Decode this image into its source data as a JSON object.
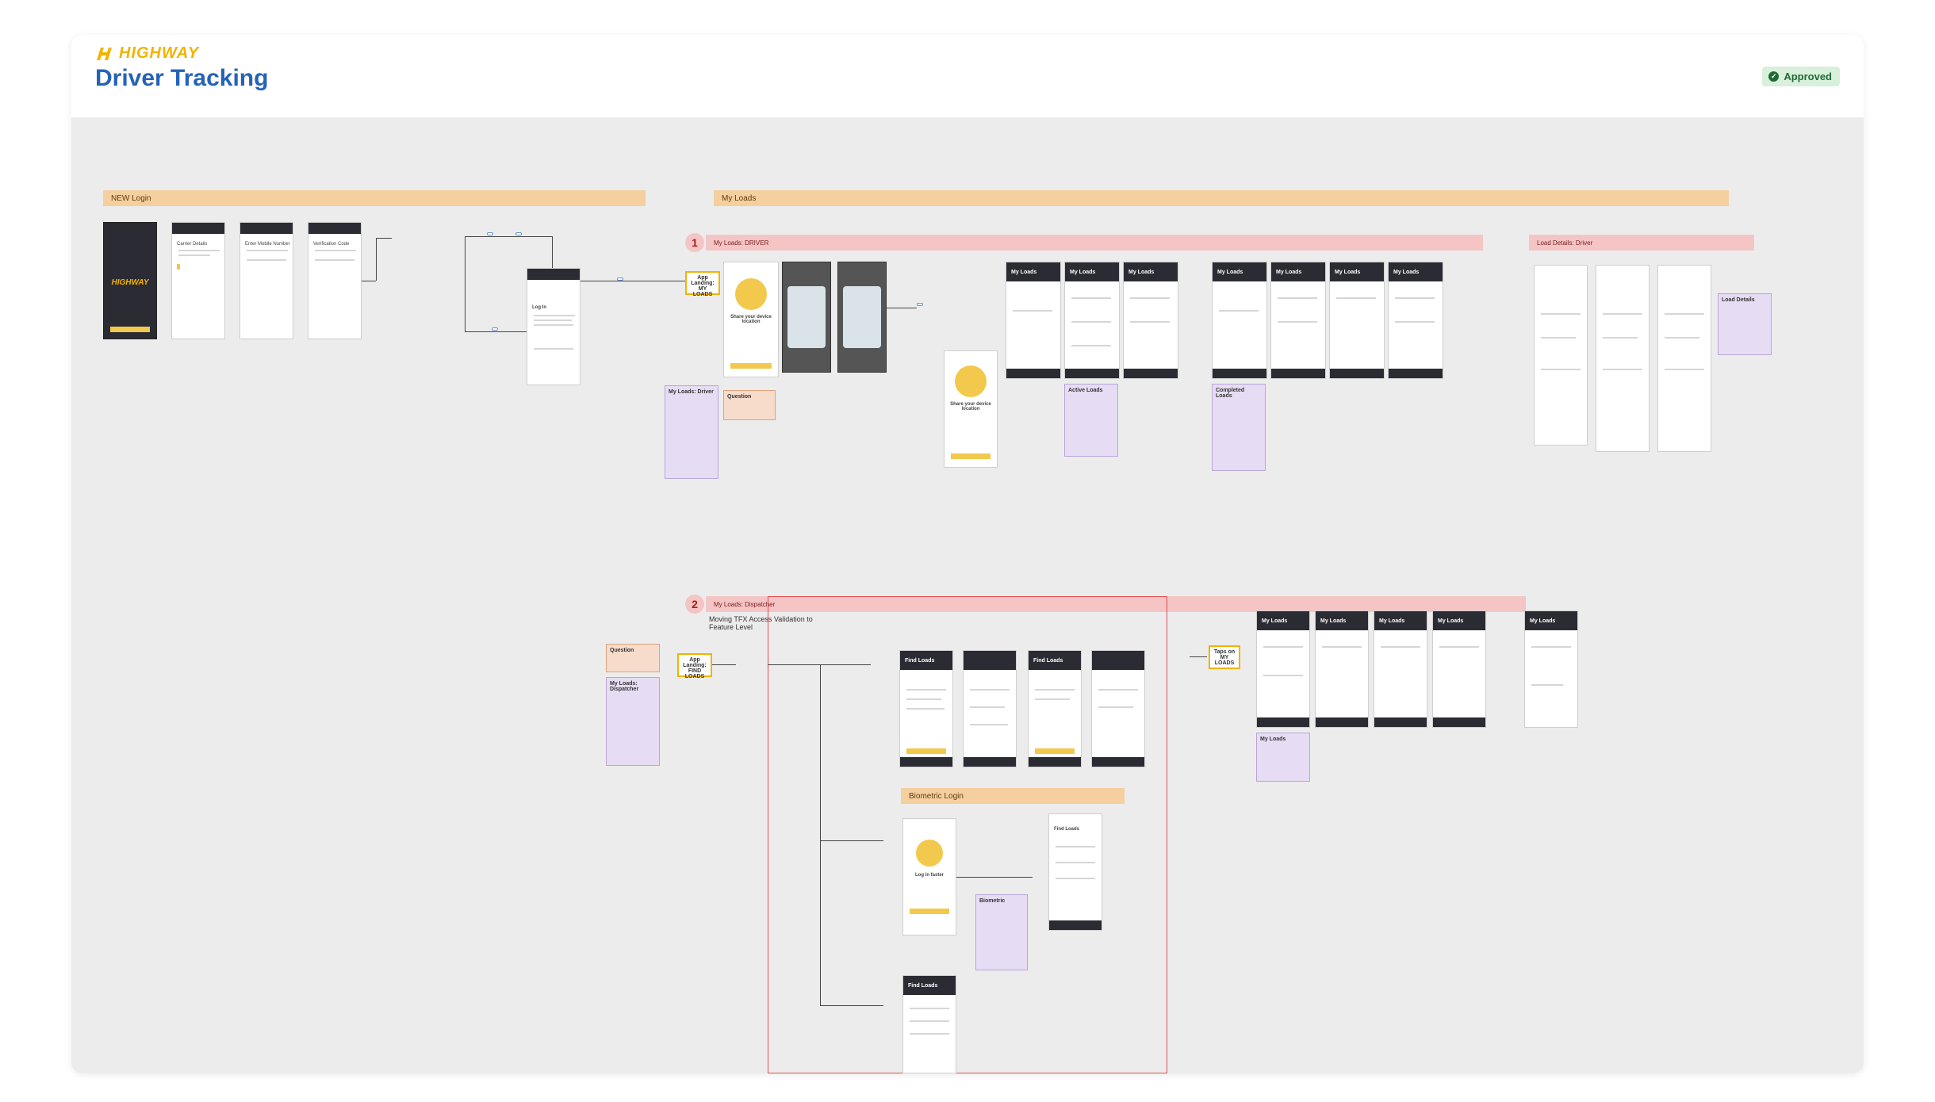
{
  "header": {
    "logo_text": "HIGHWAY",
    "title": "Driver Tracking",
    "status_badge": "Approved"
  },
  "sections": {
    "new_login": "NEW Login",
    "my_loads": "My Loads",
    "driver_band": "My Loads: DRIVER",
    "dispatcher_band": "My Loads: Dispatcher",
    "load_details_band": "Load Details: Driver",
    "biometric_band": "Biometric Login",
    "number_1": "1",
    "number_2": "2"
  },
  "flow": {
    "app_landing_my_loads": "App Landing: MY LOADS",
    "app_landing_find_loads": "App Landing: FIND LOADS",
    "moving_tfx": "Moving TFX Access Validation to Feature Level",
    "taps_on_my_loads": "Taps on MY LOADS"
  },
  "screens": {
    "brand": "HIGHWAY",
    "carrier_details": "Carrier Details",
    "enter_mobile": "Enter Mobile Number",
    "verification_code": "Verification Code",
    "log_in": "Log In",
    "share_location": "Share your device location",
    "my_loads": "My Loads",
    "find_loads": "Find Loads",
    "log_in_faster": "Log in faster"
  },
  "notes": {
    "my_loads_driver": "My Loads: Driver",
    "question": "Question",
    "active_loads": "Active Loads",
    "completed_loads": "Completed Loads",
    "load_details": "Load Details",
    "my_loads_dispatcher": "My Loads: Dispatcher",
    "biometric": "Biometric",
    "my_loads": "My Loads"
  }
}
